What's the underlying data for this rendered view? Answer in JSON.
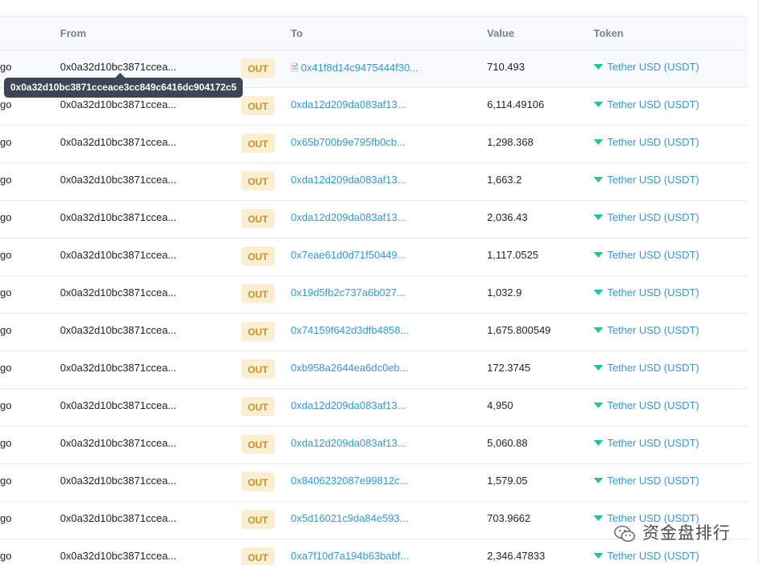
{
  "headers": {
    "from": "From",
    "to": "To",
    "value": "Value",
    "token": "Token"
  },
  "tooltip": "0x0a32d10bc3871cceace3cc849c6416dc904172c5",
  "watermark": "资金盘排行",
  "rows": [
    {
      "age": "go",
      "from": "0x0a32d10bc3871ccea...",
      "direction": "OUT",
      "to": "0x41f8d14c9475444f30...",
      "to_is_contract": true,
      "value": "710.493",
      "token": "Tether USD (USDT)"
    },
    {
      "age": "go",
      "from": "0x0a32d10bc3871ccea...",
      "direction": "OUT",
      "to": "0xda12d209da083af13...",
      "value": "6,114.49106",
      "token": "Tether USD (USDT)"
    },
    {
      "age": "go",
      "from": "0x0a32d10bc3871ccea...",
      "direction": "OUT",
      "to": "0x65b700b9e795fb0cb...",
      "value": "1,298.368",
      "token": "Tether USD (USDT)"
    },
    {
      "age": "go",
      "from": "0x0a32d10bc3871ccea...",
      "direction": "OUT",
      "to": "0xda12d209da083af13...",
      "value": "1,663.2",
      "token": "Tether USD (USDT)"
    },
    {
      "age": "go",
      "from": "0x0a32d10bc3871ccea...",
      "direction": "OUT",
      "to": "0xda12d209da083af13...",
      "value": "2,036.43",
      "token": "Tether USD (USDT)"
    },
    {
      "age": "go",
      "from": "0x0a32d10bc3871ccea...",
      "direction": "OUT",
      "to": "0x7eae61d0d71f50449...",
      "value": "1,117.0525",
      "token": "Tether USD (USDT)"
    },
    {
      "age": "go",
      "from": "0x0a32d10bc3871ccea...",
      "direction": "OUT",
      "to": "0x19d5fb2c737a6b027...",
      "value": "1,032.9",
      "token": "Tether USD (USDT)"
    },
    {
      "age": "go",
      "from": "0x0a32d10bc3871ccea...",
      "direction": "OUT",
      "to": "0x74159f642d3dfb4858...",
      "value": "1,675.800549",
      "token": "Tether USD (USDT)"
    },
    {
      "age": "go",
      "from": "0x0a32d10bc3871ccea...",
      "direction": "OUT",
      "to": "0xb958a2644ea6dc0eb...",
      "value": "172.3745",
      "token": "Tether USD (USDT)"
    },
    {
      "age": "go",
      "from": "0x0a32d10bc3871ccea...",
      "direction": "OUT",
      "to": "0xda12d209da083af13...",
      "value": "4,950",
      "token": "Tether USD (USDT)"
    },
    {
      "age": "go",
      "from": "0x0a32d10bc3871ccea...",
      "direction": "OUT",
      "to": "0xda12d209da083af13...",
      "value": "5,060.88",
      "token": "Tether USD (USDT)"
    },
    {
      "age": "go",
      "from": "0x0a32d10bc3871ccea...",
      "direction": "OUT",
      "to": "0x8406232087e99812c...",
      "value": "1,579.05",
      "token": "Tether USD (USDT)"
    },
    {
      "age": "go",
      "from": "0x0a32d10bc3871ccea...",
      "direction": "OUT",
      "to": "0x5d16021c9da84e593...",
      "value": "703.9662",
      "token": "Tether USD (USDT)"
    },
    {
      "age": "go",
      "from": "0x0a32d10bc3871ccea...",
      "direction": "OUT",
      "to": "0xa7f10d7a194b63babf...",
      "value": "2,346.47833",
      "token": "Tether USD (USDT)"
    }
  ],
  "colors": {
    "link": "#3498db",
    "out_badge_bg": "#fcefd1",
    "out_badge_text": "#c8902a",
    "token_icon": "#21c4a0",
    "tooltip_bg": "#3d4656"
  }
}
